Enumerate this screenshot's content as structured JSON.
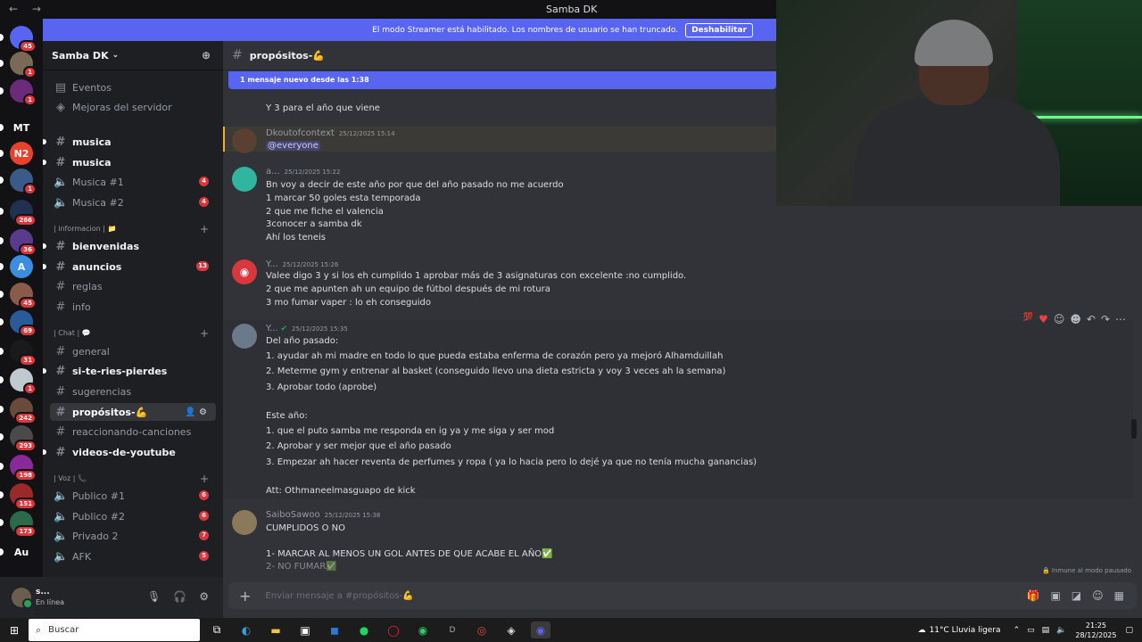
{
  "window": {
    "title": "Samba DK"
  },
  "banner": {
    "text": "El modo Streamer está habilitado. Los nombres de usuario se han truncado.",
    "button": "Deshabilitar"
  },
  "servers": [
    {
      "label": "",
      "badge": "45",
      "color": "#5865f2"
    },
    {
      "label": "",
      "badge": "1",
      "color": "#7a6a55"
    },
    {
      "label": "",
      "badge": "1",
      "color": "#6b2a7a"
    },
    {
      "label": "MT",
      "badge": "",
      "color": "#121214"
    },
    {
      "label": "N2",
      "badge": "",
      "color": "#e8412c"
    },
    {
      "label": "",
      "badge": "1",
      "color": "#3a5a8a"
    },
    {
      "label": "",
      "badge": "266",
      "color": "#203050"
    },
    {
      "label": "",
      "badge": "36",
      "color": "#5a3a8a"
    },
    {
      "label": "A",
      "badge": "",
      "color": "#3b8de0"
    },
    {
      "label": "",
      "badge": "45",
      "color": "#8a5a4a"
    },
    {
      "label": "",
      "badge": "69",
      "color": "#2a5a9a"
    },
    {
      "label": "",
      "badge": "31",
      "color": "#1a1a1a"
    },
    {
      "label": "",
      "badge": "1",
      "color": "#c0c8d0"
    },
    {
      "label": "",
      "badge": "242",
      "color": "#6a4a3a"
    },
    {
      "label": "",
      "badge": "293",
      "color": "#4a4a4a"
    },
    {
      "label": "",
      "badge": "198",
      "color": "#8a2a9a"
    },
    {
      "label": "",
      "badge": "151",
      "color": "#9a2a2a"
    },
    {
      "label": "",
      "badge": "173",
      "color": "#2a6a4a"
    },
    {
      "label": "Au",
      "badge": "",
      "color": "#121214"
    }
  ],
  "sidebar": {
    "server_name": "Samba DK",
    "top_items": [
      {
        "label": "Eventos"
      },
      {
        "label": "Mejoras del servidor"
      }
    ],
    "channels1": [
      {
        "label": "musica",
        "type": "text",
        "bold": true
      },
      {
        "label": "musica",
        "type": "text",
        "bold": true
      },
      {
        "label": "Musica #1",
        "type": "voice",
        "badge": "4"
      },
      {
        "label": "Musica #2",
        "type": "voice",
        "badge": "4"
      }
    ],
    "cat_info": "| informacion | 📁",
    "channels2": [
      {
        "label": "bienvenidas",
        "bold": true
      },
      {
        "label": "anuncios",
        "bold": true,
        "badge": "13"
      },
      {
        "label": "reglas"
      },
      {
        "label": "info"
      }
    ],
    "cat_chat": "| Chat | 💬",
    "channels3": [
      {
        "label": "general"
      },
      {
        "label": "si-te-ries-pierdes",
        "bold": true
      },
      {
        "label": "sugerencias"
      },
      {
        "label": "propósitos-💪",
        "active": true
      },
      {
        "label": "reaccionando-canciones"
      },
      {
        "label": "videos-de-youtube",
        "bold": true
      }
    ],
    "cat_voz": "| Voz | 📞",
    "channels4": [
      {
        "label": "Publico #1",
        "badge": "6"
      },
      {
        "label": "Publico #2",
        "badge": "6"
      },
      {
        "label": "Privado 2",
        "badge": "7"
      },
      {
        "label": "AFK",
        "badge": "5"
      }
    ]
  },
  "user": {
    "name": "s...",
    "status": "En línea"
  },
  "channel": {
    "name": "propósitos-💪",
    "new_messages": "1 mensaje nuevo desde las 1:38"
  },
  "messages": {
    "m0": {
      "lines": [
        "Y 3 para el año que viene"
      ]
    },
    "m1": {
      "author": "Dkoutofcontext",
      "time": "25/12/2025 15:14",
      "mention": "@everyone"
    },
    "m2": {
      "author": "a...",
      "time": "25/12/2025 15:22",
      "lines": [
        "Bn voy a decir de este año por que del año pasado no me acuerdo",
        "1 marcar 50 goles esta temporada",
        "2 que me fiche el valencia",
        "3conocer a samba dk",
        "Ahí los teneis"
      ]
    },
    "m3": {
      "author": "Y...",
      "time": "25/12/2025 15:26",
      "lines": [
        "Valee digo 3 y si los eh cumplido 1 aprobar más de 3 asignaturas con excelente :no cumplido.",
        "2 que me apunten ah un equipo de fútbol después de mi rotura",
        "3 mo fumar vaper : lo eh conseguido"
      ]
    },
    "m4": {
      "author": "Y...",
      "time": "25/12/2025 15:35",
      "lines": [
        "Del año pasado:",
        "1. ayudar ah mi madre en todo lo que pueda estaba enferma de corazón pero ya mejoró Alhamduillah",
        "2. Meterme gym y entrenar al basket (conseguido llevo una dieta estricta y voy 3 veces ah la semana)",
        "3. Aprobar todo (aprobe)",
        "Este año:",
        "1. que el puto samba me responda en ig ya y me siga y ser mod",
        "2. Aprobar y ser mejor que el año pasado",
        "3. Empezar ah hacer reventa de perfumes y ropa ( ya lo hacia pero lo dejé ya que no tenía mucha ganancias)",
        "Att: Othmaneelmasguapo de kick"
      ]
    },
    "m5": {
      "author": "SaiboSawoo",
      "time": "25/12/2025 15:38",
      "lines": [
        "CUMPLIDOS O NO",
        "1- MARCAR AL MENOS UN GOL ANTES DE QUE ACABE EL AÑO✅",
        "2- NO FUMAR✅"
      ]
    }
  },
  "pause_notice": "Inmune al modo pausado",
  "composer": {
    "placeholder": "Enviar mensaje a #propósitos-💪"
  },
  "taskbar": {
    "search": "Buscar",
    "weather": "11°C  Lluvia ligera",
    "time": "21:25",
    "date": "28/12/2025"
  },
  "colors": {
    "blurple": "#5865f2",
    "red": "#da373c",
    "online": "#23a55a"
  }
}
